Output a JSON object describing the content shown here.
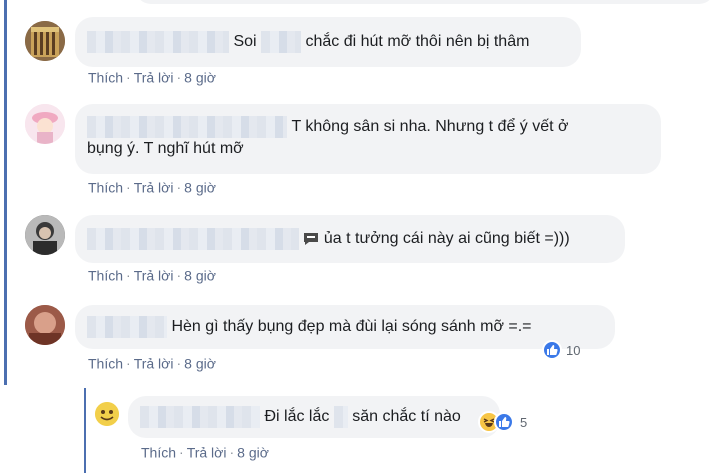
{
  "comments": [
    {
      "text": "Soi",
      "text2": "chắc đi hút mỡ thôi nên bị thâm",
      "like": "Thích",
      "reply": "Trả lời",
      "time": "8 giờ"
    },
    {
      "line1": "T không sân si nha. Nhưng t để ý vết ở",
      "line2": "bụng ý. T nghĩ hút mỡ",
      "like": "Thích",
      "reply": "Trả lời",
      "time": "8 giờ"
    },
    {
      "text": "ủa t tưởng cái này ai cũng biết =)))",
      "like": "Thích",
      "reply": "Trả lời",
      "time": "8 giờ"
    },
    {
      "text": "Hèn gì thấy bụng đẹp mà đùi lại sóng sánh mỡ =.=",
      "reaction_count": "10",
      "like": "Thích",
      "reply": "Trả lời",
      "time": "8 giờ"
    }
  ],
  "reply": {
    "text": "Đi lắc lắc",
    "text2": "săn chắc tí nào",
    "reaction_count": "5",
    "like": "Thích",
    "reply": "Trả lời",
    "time": "8 giờ"
  },
  "separator": "·",
  "colors": {
    "thread_line": "#4c6fb0",
    "link": "#5b6b8a",
    "bubble": "#f2f3f5",
    "like": "#3b79e8",
    "haha": "#f7c545"
  }
}
